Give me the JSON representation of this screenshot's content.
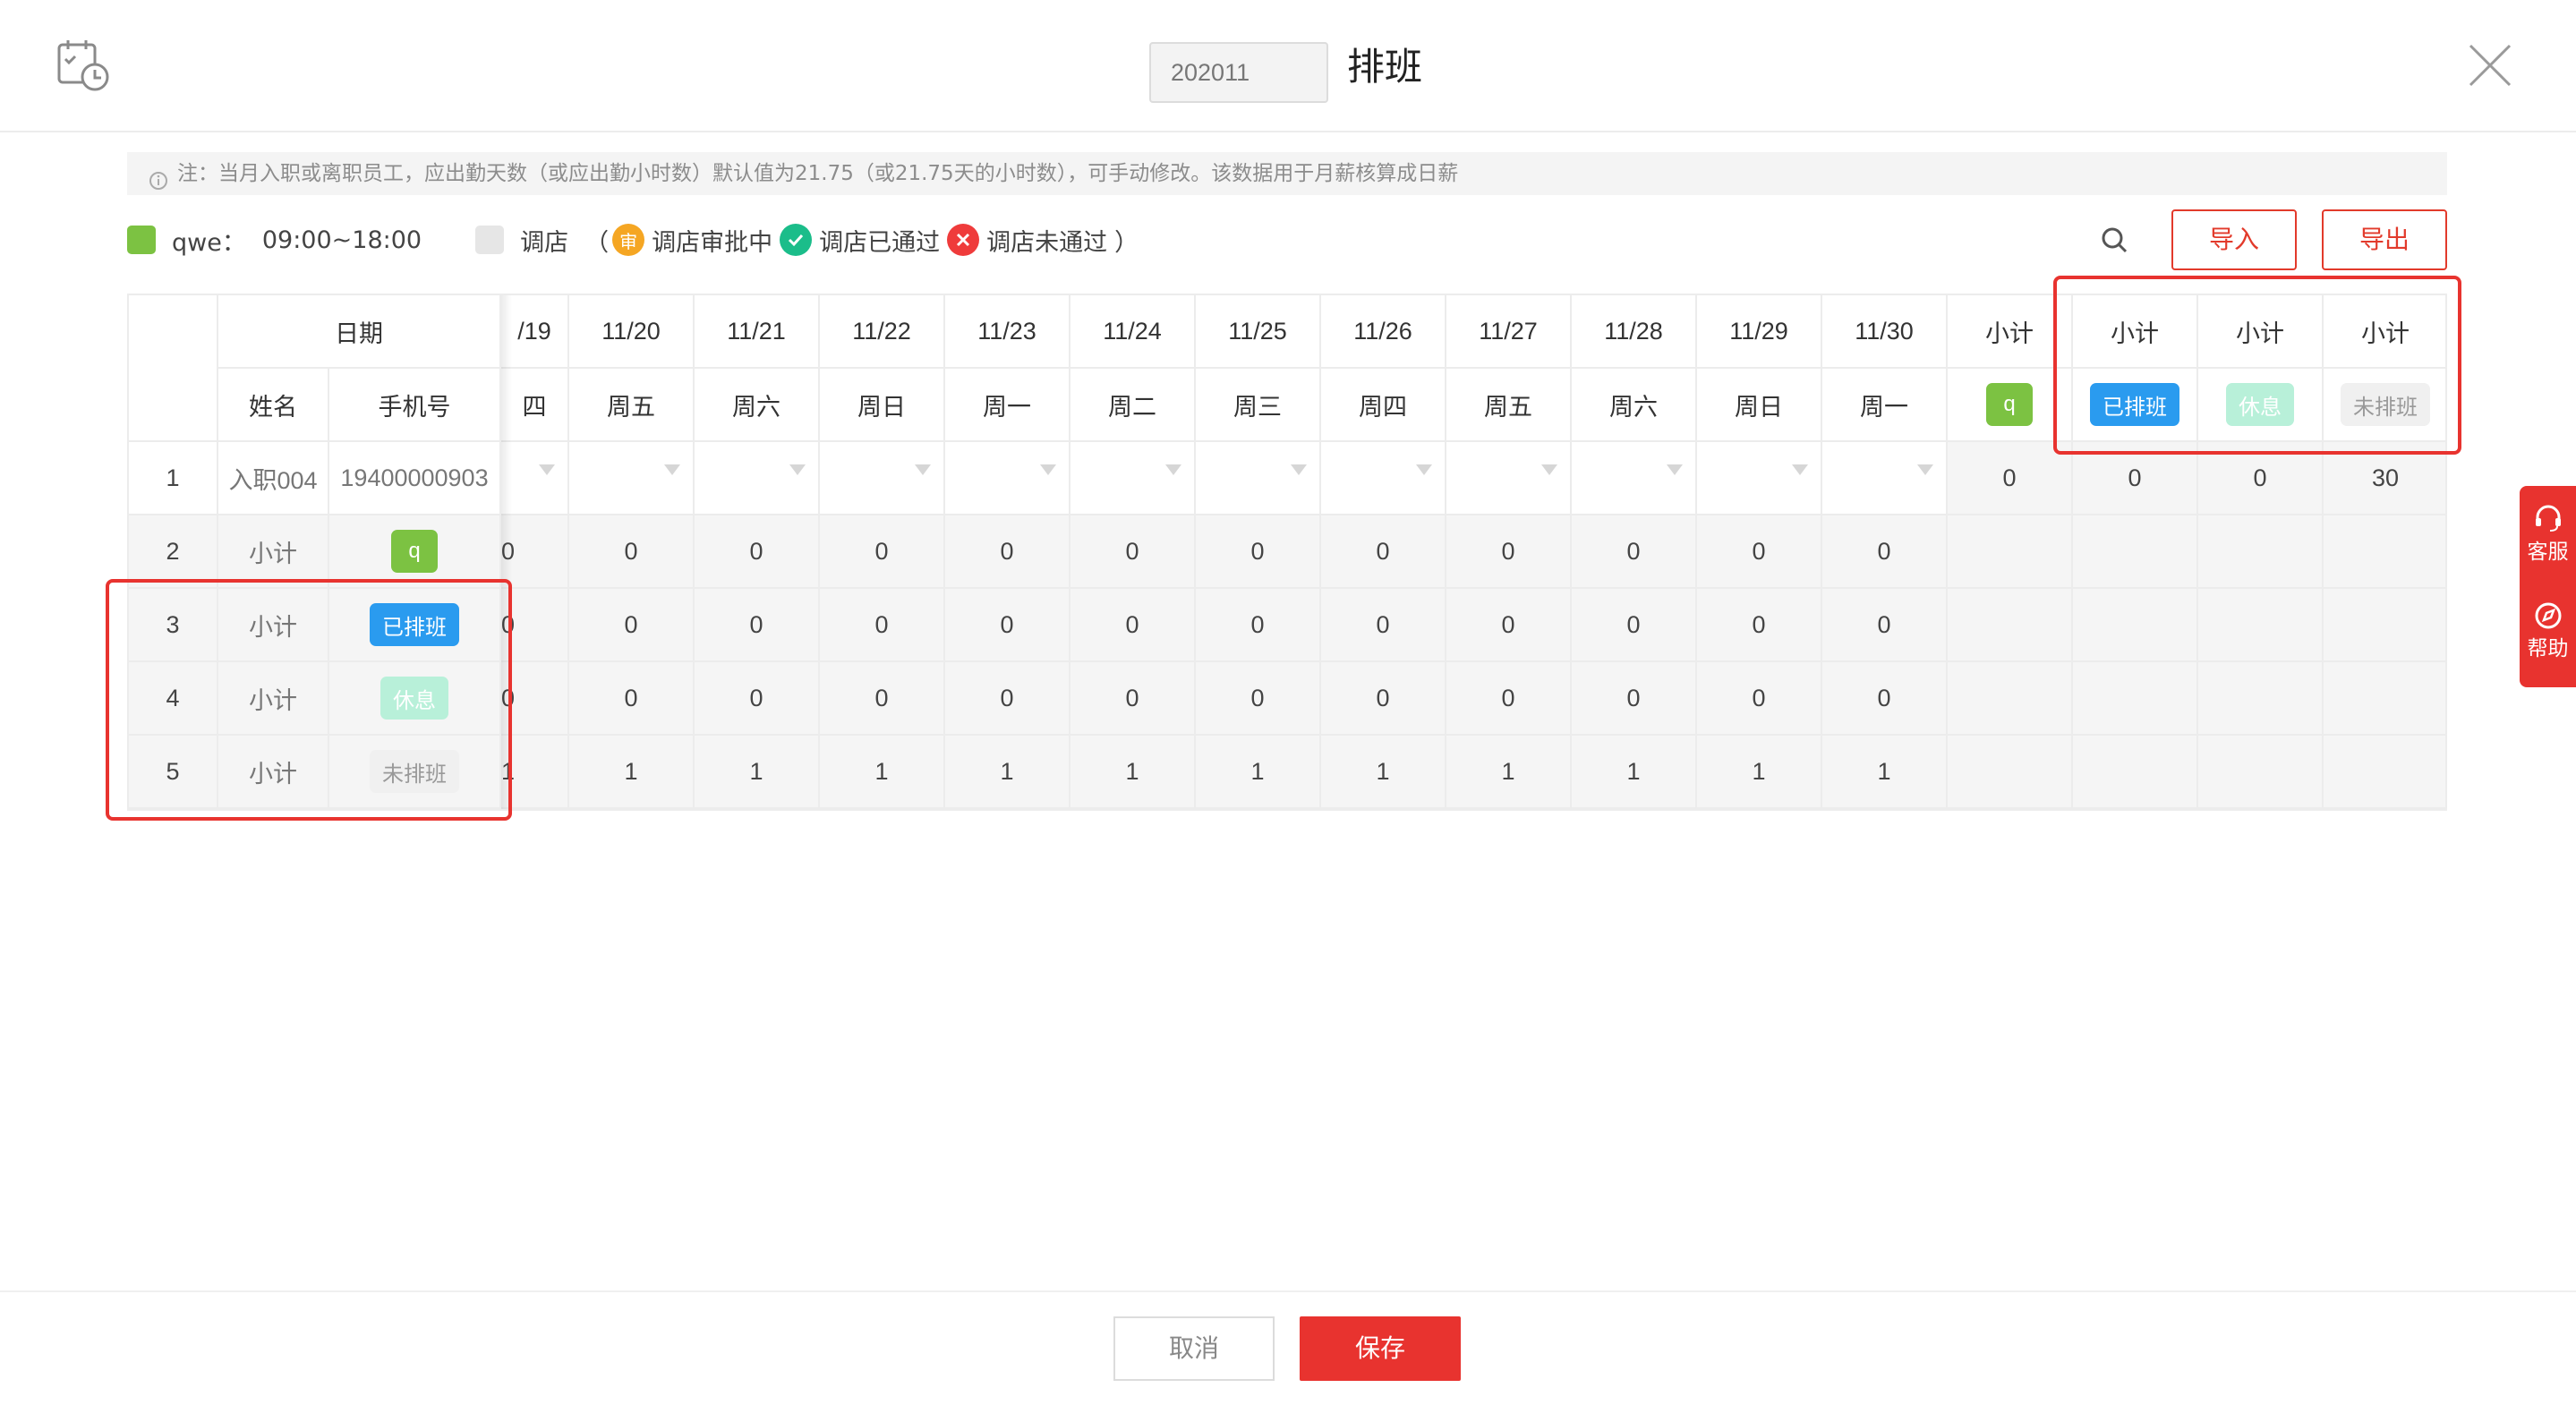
{
  "header": {
    "month_value": "202011",
    "title": "排班",
    "app_icon": "calendar-clock-icon",
    "close_icon": "close-icon"
  },
  "note": {
    "icon": "info-icon",
    "text": "注：当月入职或离职员工，应出勤天数（或应出勤小时数）默认值为21.75（或21.75天的小时数），可手动修改。该数据用于月薪核算成日薪"
  },
  "legend": {
    "shift_name": "qwe：",
    "shift_time": "09:00~18:00",
    "transfer_label": "调店",
    "paren_open": "（",
    "pending_label": "调店审批中",
    "pending_badge": "审",
    "approved_label": "调店已通过",
    "rejected_label": "调店未通过",
    "paren_close": "）",
    "colors": {
      "shift": "#7cc242",
      "transfer": "#e6e6e6",
      "pending": "#f5a623",
      "approved": "#1bbd8a",
      "rejected": "#ef3b3b"
    }
  },
  "toolbar": {
    "search_icon": "search-icon",
    "import_label": "导入",
    "export_label": "导出",
    "accent": "#e23a2b"
  },
  "table": {
    "header_date": "日期",
    "header_name": "姓名",
    "header_phone": "手机号",
    "date_columns": [
      {
        "date": "/19",
        "weekday": "四"
      },
      {
        "date": "11/20",
        "weekday": "周五"
      },
      {
        "date": "11/21",
        "weekday": "周六"
      },
      {
        "date": "11/22",
        "weekday": "周日"
      },
      {
        "date": "11/23",
        "weekday": "周一"
      },
      {
        "date": "11/24",
        "weekday": "周二"
      },
      {
        "date": "11/25",
        "weekday": "周三"
      },
      {
        "date": "11/26",
        "weekday": "周四"
      },
      {
        "date": "11/27",
        "weekday": "周五"
      },
      {
        "date": "11/28",
        "weekday": "周六"
      },
      {
        "date": "11/29",
        "weekday": "周日"
      },
      {
        "date": "11/30",
        "weekday": "周一"
      }
    ],
    "subtotal_columns": [
      {
        "label": "小计",
        "tag": "q",
        "tag_style": "green"
      },
      {
        "label": "小计",
        "tag": "已排班",
        "tag_style": "blue"
      },
      {
        "label": "小计",
        "tag": "休息",
        "tag_style": "mint"
      },
      {
        "label": "小计",
        "tag": "未排班",
        "tag_style": "gray"
      }
    ],
    "employee_row": {
      "index": "1",
      "name": "入职004",
      "phone": "19400000903",
      "subtotals": [
        "0",
        "0",
        "0",
        "30"
      ]
    },
    "summary_rows": [
      {
        "index": "2",
        "label": "小计",
        "tag": "q",
        "tag_style": "green",
        "first": "0",
        "values": [
          "0",
          "0",
          "0",
          "0",
          "0",
          "0",
          "0",
          "0",
          "0",
          "0",
          "0"
        ]
      },
      {
        "index": "3",
        "label": "小计",
        "tag": "已排班",
        "tag_style": "blue",
        "first": "0",
        "values": [
          "0",
          "0",
          "0",
          "0",
          "0",
          "0",
          "0",
          "0",
          "0",
          "0",
          "0"
        ]
      },
      {
        "index": "4",
        "label": "小计",
        "tag": "休息",
        "tag_style": "mint",
        "first": "0",
        "values": [
          "0",
          "0",
          "0",
          "0",
          "0",
          "0",
          "0",
          "0",
          "0",
          "0",
          "0"
        ]
      },
      {
        "index": "5",
        "label": "小计",
        "tag": "未排班",
        "tag_style": "gray",
        "first": "1",
        "values": [
          "1",
          "1",
          "1",
          "1",
          "1",
          "1",
          "1",
          "1",
          "1",
          "1",
          "1"
        ]
      }
    ]
  },
  "float_service": {
    "service_label": "客服",
    "service_icon": "headset-icon",
    "help_label": "帮助",
    "help_icon": "compass-icon"
  },
  "footer": {
    "cancel_label": "取消",
    "save_label": "保存"
  }
}
